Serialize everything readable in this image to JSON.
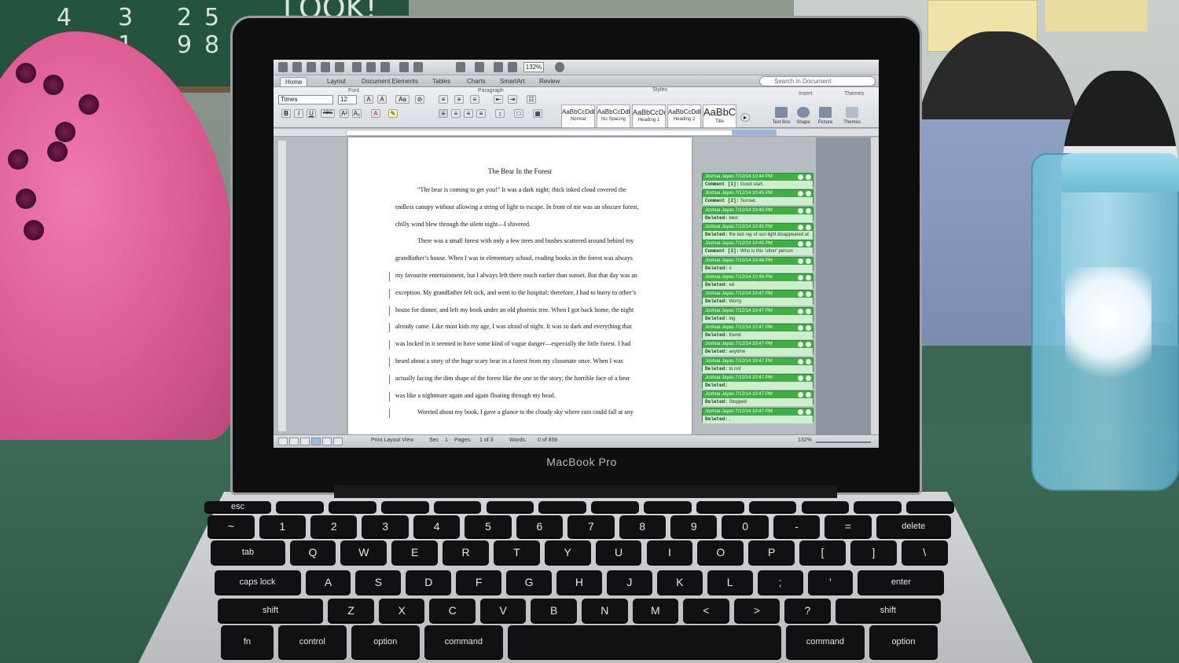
{
  "scene": {
    "chalk_text": [
      "LOOK!",
      "4",
      "3",
      "2",
      "5",
      "2",
      "1",
      "9",
      "8"
    ],
    "laptop_brand": "MacBook Pro"
  },
  "word": {
    "zoom": "132%",
    "search_placeholder": "Search in Document",
    "tabs": [
      "Home",
      "Layout",
      "Document Elements",
      "Tables",
      "Charts",
      "SmartArt",
      "Review"
    ],
    "group_labels": [
      "Font",
      "Paragraph",
      "Styles",
      "Insert",
      "Themes"
    ],
    "font_name": "Times",
    "font_size": "12",
    "format_buttons": [
      "B",
      "I",
      "U",
      "ABC",
      "A²",
      "A₂"
    ],
    "styles": [
      {
        "sample": "AaBbCcDdEe",
        "name": "Normal"
      },
      {
        "sample": "AaBbCcDdEe",
        "name": "No Spacing"
      },
      {
        "sample": "AaBbCcDc",
        "name": "Heading 1"
      },
      {
        "sample": "AaBbCcDdEe",
        "name": "Heading 2"
      },
      {
        "sample": "AaBbC",
        "name": "Title"
      }
    ],
    "insert_buttons": [
      "Text Box",
      "Shape",
      "Picture",
      "Themes"
    ],
    "document": {
      "title": "The Bear In the Forest",
      "lines": [
        {
          "text": "“The bear is coming to get you!” It was a dark night; thick inked cloud covered the",
          "indent": true
        },
        {
          "text": "endless canopy without allowing a string of light to escape. In front of me was an obscure forest,",
          "indent": false
        },
        {
          "text": "chilly wind blew through the silent night—I shivered.",
          "indent": false
        },
        {
          "text": "There was a small forest with only a few trees and bushes scattered around behind my",
          "indent": true
        },
        {
          "text": "grandfather’s house. When I was in elementary school, reading books in the forest was always",
          "indent": false
        },
        {
          "text": "my favourite entertainment, but I always left there much earlier than sunset. But that day was an",
          "indent": false
        },
        {
          "text": "exception. My grandfather felt sick, and went to the hospital; therefore, I had to hurry to other’s",
          "indent": false
        },
        {
          "text": "house for dinner, and left my book under an old phoenix tree.  When I got back home, the night",
          "indent": false
        },
        {
          "text": "already came. Like most kids my age, I was afraid of night. It was so dark and everything that",
          "indent": false
        },
        {
          "text": "was locked in it seemed to have some kind of vague danger—especially the little forest. I had",
          "indent": false
        },
        {
          "text": "heard about a story of the huge scary bear in a forest from my classmate once. When I was",
          "indent": false
        },
        {
          "text": "actually facing the dim shape of the forest like the one in the story; the horrible face of a bear",
          "indent": false
        },
        {
          "text": "was like a nightmare again and again floating through my head.",
          "indent": false
        },
        {
          "text": "Worried about my book, I gave a glance to the cloudy sky where rain could fall at any",
          "indent": true
        }
      ]
    },
    "comments": [
      {
        "author": "Joshua Jayas",
        "time": "7/12/14 10:44 PM",
        "kind": "Comment [1]:",
        "text": "Good start."
      },
      {
        "author": "Joshua Jayas",
        "time": "7/12/14 10:45 PM",
        "kind": "Comment [2]:",
        "text": "Sunset."
      },
      {
        "author": "Joshua Jayas",
        "time": "7/12/14 10:45 PM",
        "kind": "Deleted:",
        "text": "best"
      },
      {
        "author": "Joshua Jayas",
        "time": "7/12/14 10:45 PM",
        "kind": "Deleted:",
        "text": "the last ray of sun light disappeared at the horizon"
      },
      {
        "author": "Joshua Jayas",
        "time": "7/12/14 10:45 PM",
        "kind": "Comment [3]:",
        "text": "Who is this 'other' person"
      },
      {
        "author": "Joshua Jayas",
        "time": "7/12/14 10:46 PM",
        "kind": "Deleted:",
        "text": "s"
      },
      {
        "author": "Joshua Jayas",
        "time": "7/12/14 10:46 PM",
        "kind": "Deleted:",
        "text": "ed"
      },
      {
        "author": "Joshua Jayas",
        "time": "7/12/14 10:47 PM",
        "kind": "Deleted:",
        "text": "Worry"
      },
      {
        "author": "Joshua Jayas",
        "time": "7/12/14 10:47 PM",
        "kind": "Deleted:",
        "text": "ing"
      },
      {
        "author": "Joshua Jayas",
        "time": "7/12/14 10:47 PM",
        "kind": "Deleted:",
        "text": "friend"
      },
      {
        "author": "Joshua Jayas",
        "time": "7/12/14 10:47 PM",
        "kind": "Deleted:",
        "text": "anytime"
      },
      {
        "author": "Joshua Jayas",
        "time": "7/12/14 10:47 PM",
        "kind": "Deleted:",
        "text": "to not"
      },
      {
        "author": "Joshua Jayas",
        "time": "7/12/14 10:47 PM",
        "kind": "Deleted:",
        "text": ""
      },
      {
        "author": "Joshua Jayas",
        "time": "7/12/14 10:47 PM",
        "kind": "Deleted:",
        "text": "Stopped"
      },
      {
        "author": "Joshua Jayas",
        "time": "7/12/14 10:47 PM",
        "kind": "Deleted:",
        "text": ","
      }
    ],
    "status": {
      "view": "Print Layout View",
      "sec_label": "Sec",
      "sec": "1",
      "pages_label": "Pages:",
      "pages": "1 of 3",
      "words_label": "Words:",
      "words": "0 of 856",
      "zoom": "132%"
    },
    "colors": {
      "accent_green": "#3fae45",
      "ribbon": "#d9dce0"
    }
  },
  "keyboard": {
    "rows": [
      [
        "esc",
        "",
        "",
        "",
        "",
        "",
        "",
        "",
        "",
        "",
        "",
        "",
        "",
        ""
      ],
      [
        "~",
        "1",
        "2",
        "3",
        "4",
        "5",
        "6",
        "7",
        "8",
        "9",
        "0",
        "-",
        "=",
        "delete"
      ],
      [
        "tab",
        "Q",
        "W",
        "E",
        "R",
        "T",
        "Y",
        "U",
        "I",
        "O",
        "P",
        "[",
        "]",
        "\\"
      ],
      [
        "caps lock",
        "A",
        "S",
        "D",
        "F",
        "G",
        "H",
        "J",
        "K",
        "L",
        ";",
        "'",
        "enter"
      ],
      [
        "shift",
        "Z",
        "X",
        "C",
        "V",
        "B",
        "N",
        "M",
        "<",
        ">",
        "?",
        "shift"
      ],
      [
        "fn",
        "control",
        "option",
        "command",
        "",
        "command",
        "option"
      ]
    ]
  }
}
